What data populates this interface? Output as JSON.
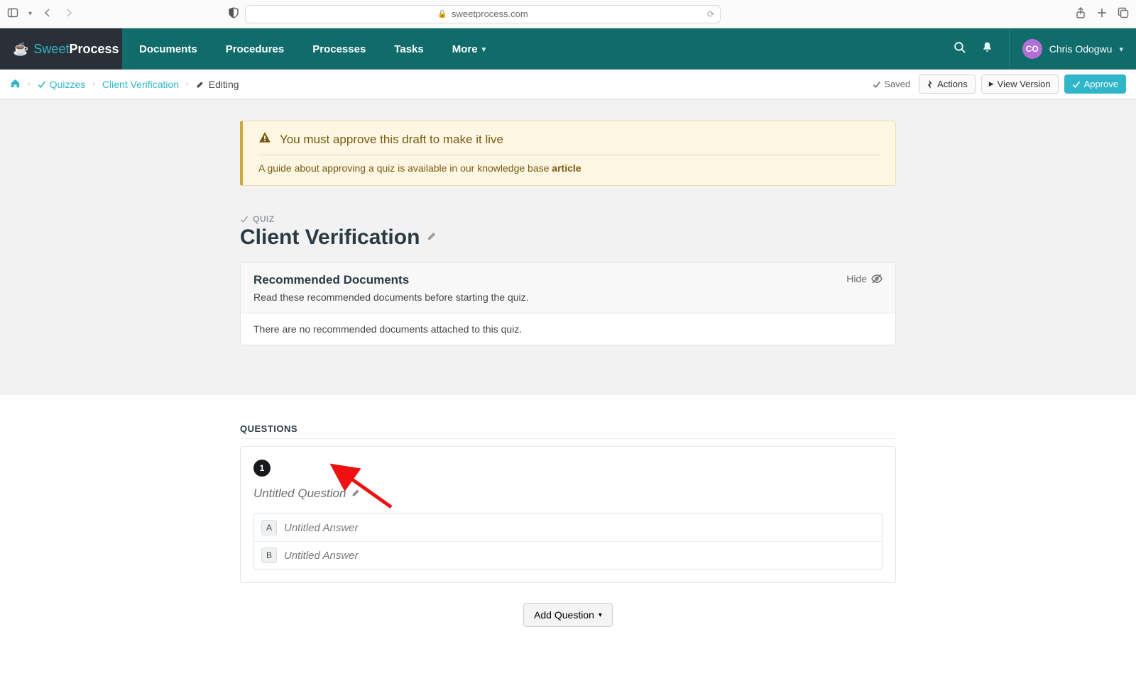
{
  "browser": {
    "url_host": "sweetprocess.com"
  },
  "brand": {
    "thin": "Sweet",
    "bold": "Process"
  },
  "nav": {
    "items": [
      "Documents",
      "Procedures",
      "Processes",
      "Tasks"
    ],
    "more": "More"
  },
  "user": {
    "initials": "CO",
    "name": "Chris Odogwu"
  },
  "breadcrumb": {
    "quizzes": "Quizzes",
    "item": "Client Verification",
    "current": "Editing"
  },
  "status": {
    "saved": "Saved"
  },
  "buttons": {
    "actions": "Actions",
    "view_version": "View Version",
    "approve": "Approve"
  },
  "alert": {
    "title": "You must approve this draft to make it live",
    "sub_prefix": "A guide about approving a quiz is available in our knowledge base ",
    "sub_link": "article"
  },
  "quiz": {
    "label": "QUIZ",
    "title": "Client Verification"
  },
  "recdocs": {
    "heading": "Recommended Documents",
    "sub": "Read these recommended documents before starting the quiz.",
    "hide": "Hide",
    "empty": "There are no recommended documents attached to this quiz."
  },
  "questions": {
    "heading": "QUESTIONS",
    "items": [
      {
        "num": "1",
        "title": "Untitled Question",
        "answers": [
          {
            "letter": "A",
            "text": "Untitled Answer"
          },
          {
            "letter": "B",
            "text": "Untitled Answer"
          }
        ]
      }
    ],
    "add": "Add Question"
  }
}
